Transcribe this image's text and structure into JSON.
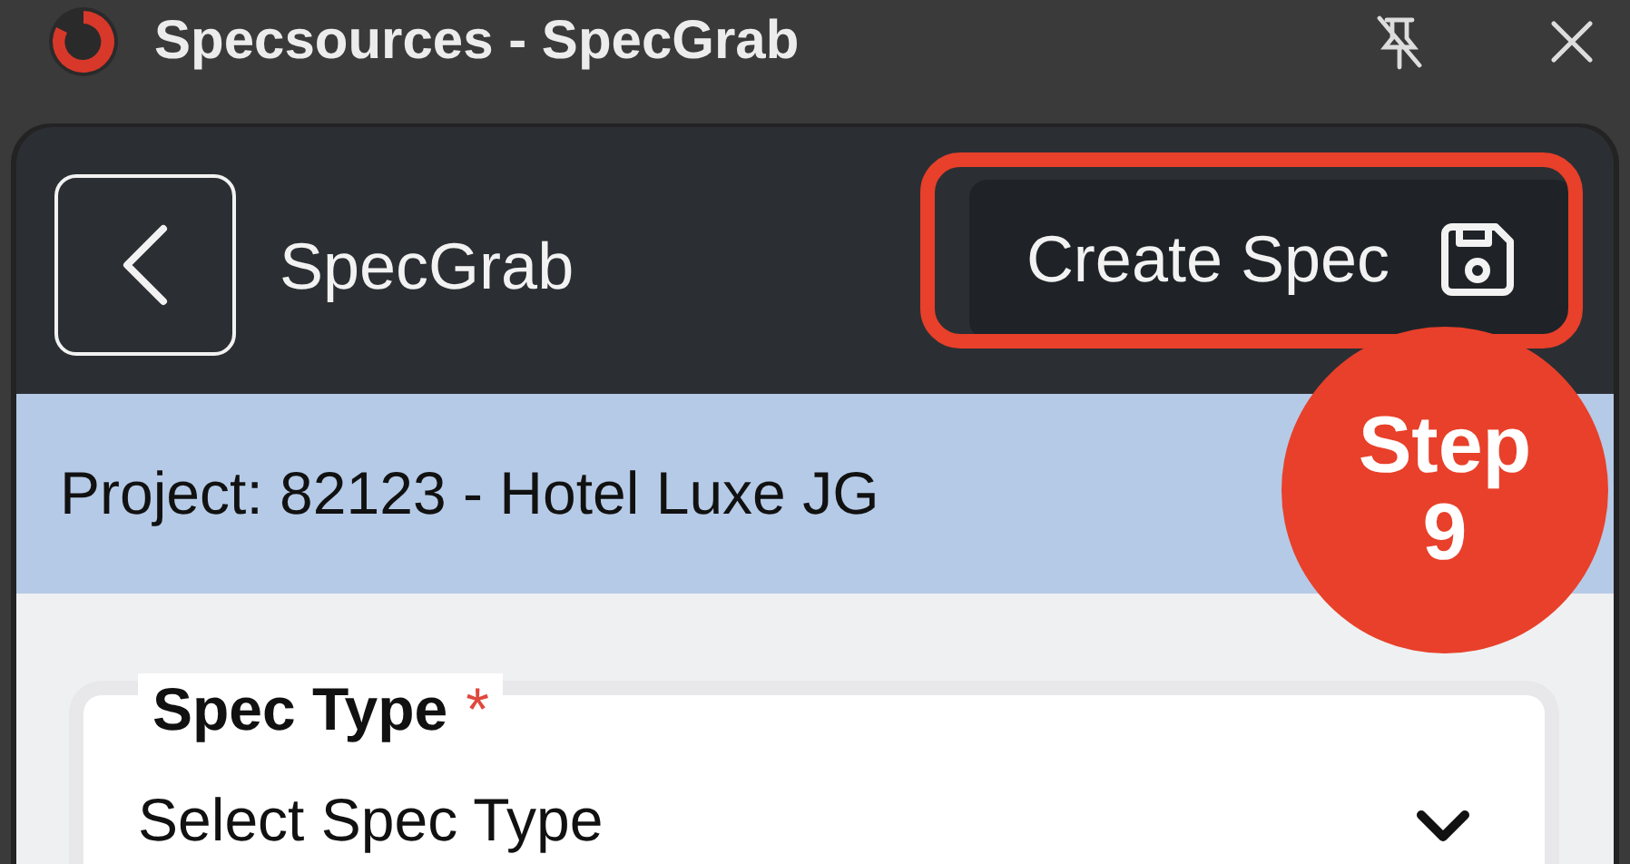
{
  "window": {
    "title": "Specsources - SpecGrab"
  },
  "header": {
    "title": "SpecGrab",
    "action": "Create Spec"
  },
  "annotation": {
    "label": "Step",
    "number": "9"
  },
  "project": {
    "text": "Project: 82123 - Hotel Luxe JG"
  },
  "form": {
    "fields": [
      {
        "label": "Spec Type",
        "required_mark": "*",
        "placeholder": "Select Spec Type"
      }
    ]
  }
}
